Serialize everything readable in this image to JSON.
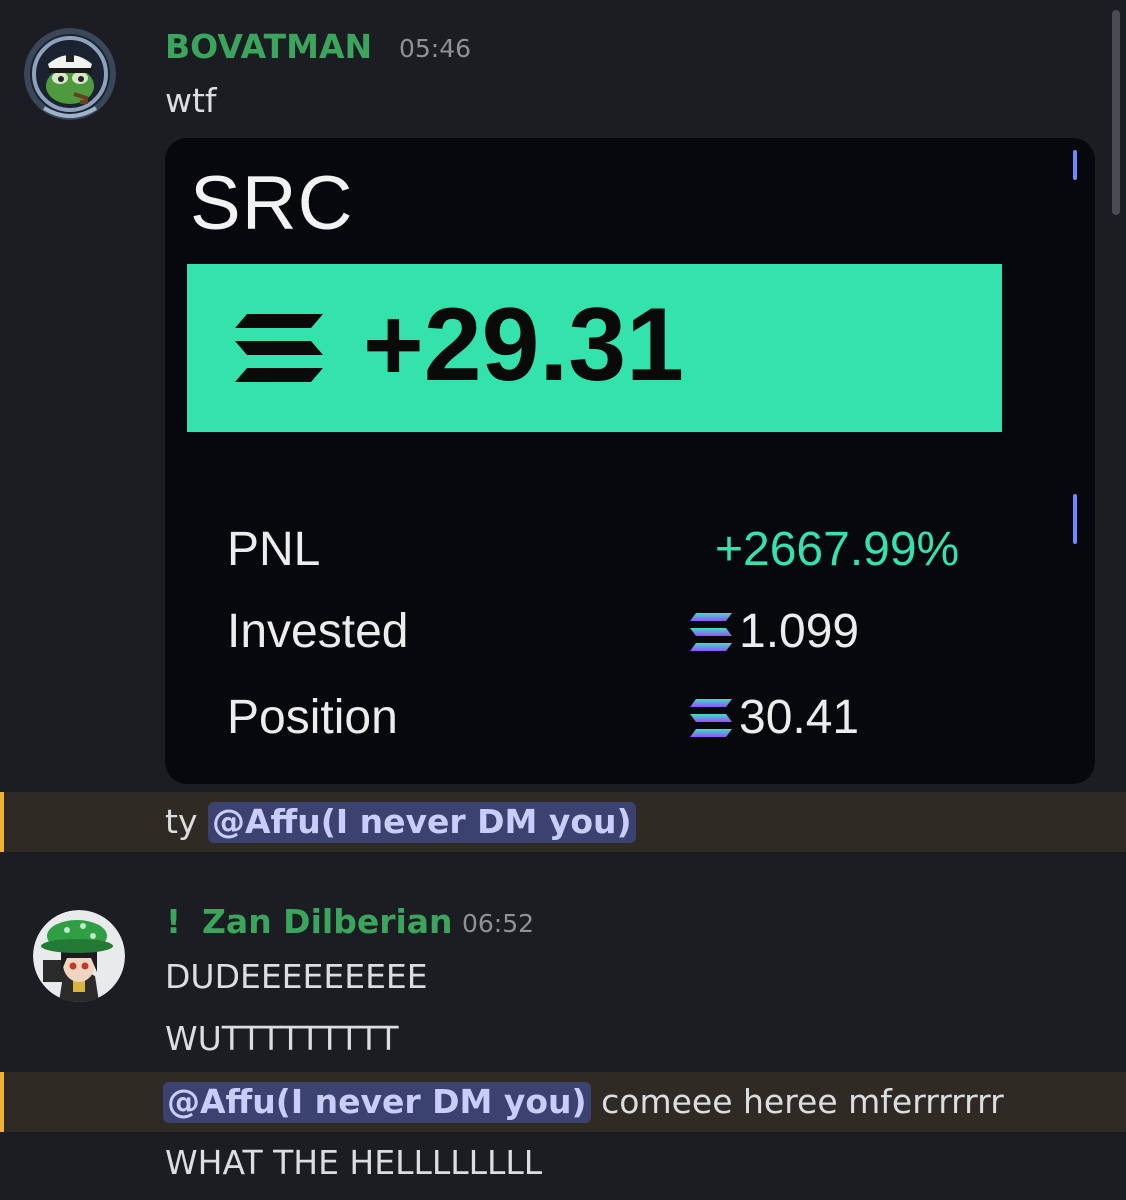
{
  "messages": [
    {
      "author": "BOVATMAN",
      "author_color": "#3ba55d",
      "time": "05:46",
      "lines": [
        "wtf"
      ],
      "attachment": {
        "title": "SRC",
        "amount": "+29.31",
        "rows": [
          {
            "label": "PNL",
            "value": "+2667.99%"
          },
          {
            "label": "Invested",
            "value": "1.099"
          },
          {
            "label": "Position",
            "value": "30.41"
          }
        ]
      },
      "mention_line": {
        "prefix": "ty ",
        "mention": "@Affu(I never DM you)"
      }
    },
    {
      "badge": "!",
      "author": "Zan Dilberian",
      "author_color": "#3ba55d",
      "time": "06:52",
      "lines": [
        "DUDEEEEEEEEE",
        "WUTTTTTTTTT"
      ],
      "mention_line": {
        "mention": "@Affu(I never DM you)",
        "suffix": " comeee heree mferrrrrrr"
      },
      "last_line": "WHAT THE HELLLLLLLL"
    }
  ],
  "colors": {
    "background": "#1c1d22",
    "mention_bg": "#3c4270",
    "highlight_bg": "#2f2b24",
    "highlight_bar": "#f0b232",
    "pnl_green": "#34e3ab"
  },
  "icons": [
    "avatar-captain-frog",
    "avatar-green-hat-girl",
    "solana-logo-icon"
  ]
}
